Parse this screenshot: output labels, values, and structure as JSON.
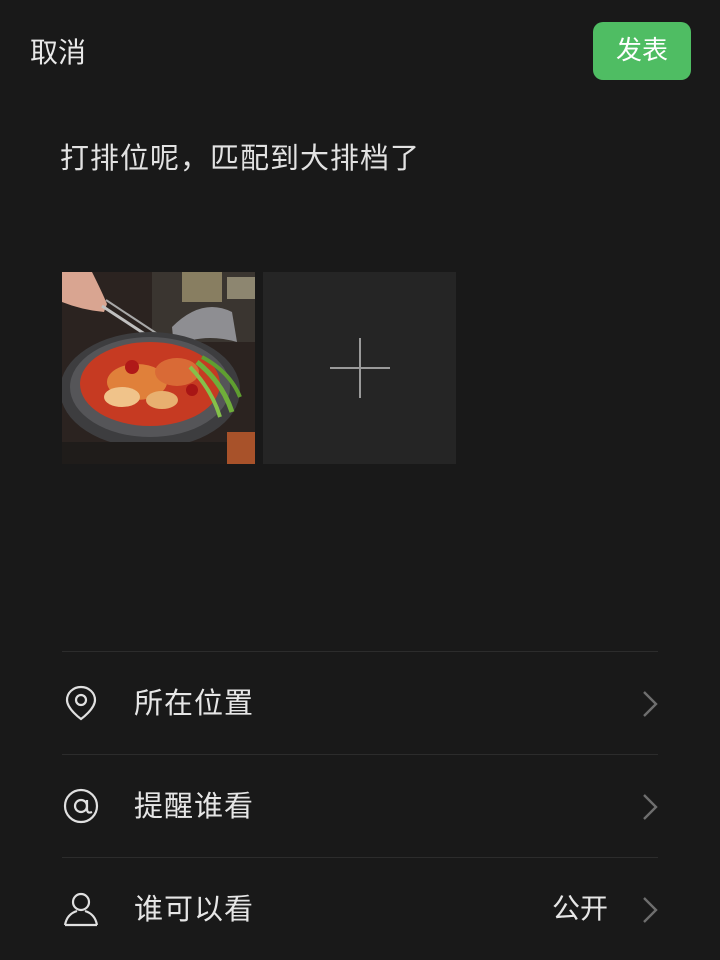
{
  "header": {
    "cancel_label": "取消",
    "publish_label": "发表"
  },
  "post": {
    "text": "打排位呢，匹配到大排档了"
  },
  "media": {
    "photo_icon": "food-photo",
    "add_icon": "plus-icon"
  },
  "options": [
    {
      "label": "所在位置",
      "icon": "location-pin-icon",
      "value": ""
    },
    {
      "label": "提醒谁看",
      "icon": "at-icon",
      "value": ""
    },
    {
      "label": "谁可以看",
      "icon": "person-icon",
      "value": "公开"
    }
  ],
  "colors": {
    "background": "#191919",
    "accent": "#4fbd63",
    "text": "#e6e6e6",
    "divider": "#2c2c2c"
  }
}
